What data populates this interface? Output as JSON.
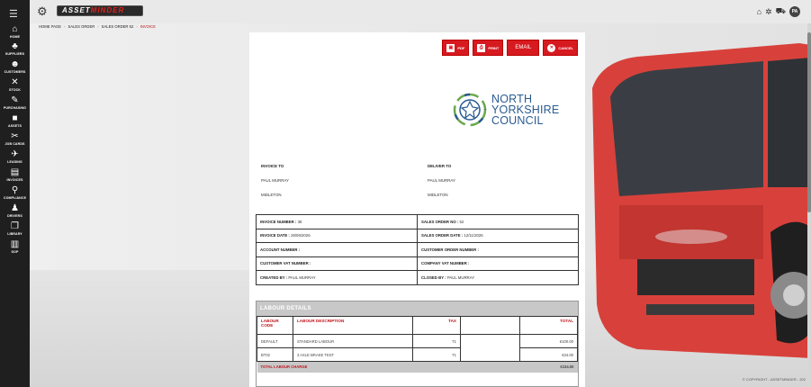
{
  "app": {
    "logo_prefix": "ASSET",
    "logo_suffix": "MINDER",
    "avatar_initials": "PA",
    "copyright": "© COPYRIGHT - ASSETMINDER - 202"
  },
  "sidebar": {
    "items": [
      {
        "label": "HOME",
        "icon": "home-icon"
      },
      {
        "label": "SUPPLIERS",
        "icon": "suppliers-icon"
      },
      {
        "label": "CUSTOMERS",
        "icon": "customers-icon"
      },
      {
        "label": "STOCK",
        "icon": "stock-icon"
      },
      {
        "label": "PURCHASING",
        "icon": "purchasing-icon"
      },
      {
        "label": "ASSETS",
        "icon": "assets-icon"
      },
      {
        "label": "JOB CARDS",
        "icon": "job-cards-icon"
      },
      {
        "label": "LEASING",
        "icon": "leasing-icon"
      },
      {
        "label": "INVOICES",
        "icon": "invoices-icon"
      },
      {
        "label": "COMPLIANCE",
        "icon": "compliance-icon"
      },
      {
        "label": "DRIVERS",
        "icon": "drivers-icon"
      },
      {
        "label": "LIBRARY",
        "icon": "library-icon"
      },
      {
        "label": "SOP",
        "icon": "sop-icon"
      }
    ]
  },
  "breadcrumb": [
    "HOME PAGE",
    "SALES ORDER",
    "SALES ORDER 52",
    "INVOICE"
  ],
  "actions": {
    "pdf": "PDF",
    "print": "PRINT",
    "email": "EMAIL",
    "cancel": "CANCEL"
  },
  "council": {
    "line1": "NORTH",
    "line2": "YORKSHIRE",
    "line3": "COUNCIL"
  },
  "invoice_to": {
    "heading": "INVOICE TO",
    "name": "PAUL MURRAY",
    "place": "MIDLETON"
  },
  "deliver_to": {
    "heading": "DELIVER TO",
    "name": "PAUL MURRAY",
    "place": "MIDLETON"
  },
  "info": {
    "invoice_number_label": "INVOICE NUMBER :",
    "invoice_number": "38",
    "sales_order_no_label": "SALES ORDER NO :",
    "sales_order_no": "52",
    "invoice_date_label": "INVOICE DATE :",
    "invoice_date": "26/06/2026",
    "sales_order_date_label": "SALES ORDER DATE :",
    "sales_order_date": "12/11/2026",
    "account_number_label": "ACCOUNT NUMBER :",
    "customer_order_number_label": "CUSTOMER ORDER NUMBER :",
    "customer_vat_label": "CUSTOMER VAT NUMBER :",
    "company_vat_label": "COMPANY VAT NUMBER :",
    "created_by_label": "CREATED BY :",
    "created_by": "PAUL MURRAY",
    "closed_by_label": "CLOSED BY :",
    "closed_by": "PAUL MURRAY"
  },
  "labour": {
    "title": "LABOUR DETAILS",
    "headers": {
      "code": "LABOUR CODE",
      "description": "LABOUR DESCRIPTION",
      "tax": "TAX",
      "total": "TOTAL"
    },
    "rows": [
      {
        "code": "DEFAULT",
        "description": "STANDARD LABOUR",
        "tax": "T1",
        "total": "€100.00"
      },
      {
        "code": "BT02",
        "description": "3 AXLE BRAKE TEST",
        "tax": "T1",
        "total": "€34.00"
      }
    ],
    "total_label": "TOTAL LABOUR CHARGE",
    "total_value": "€134.00"
  }
}
